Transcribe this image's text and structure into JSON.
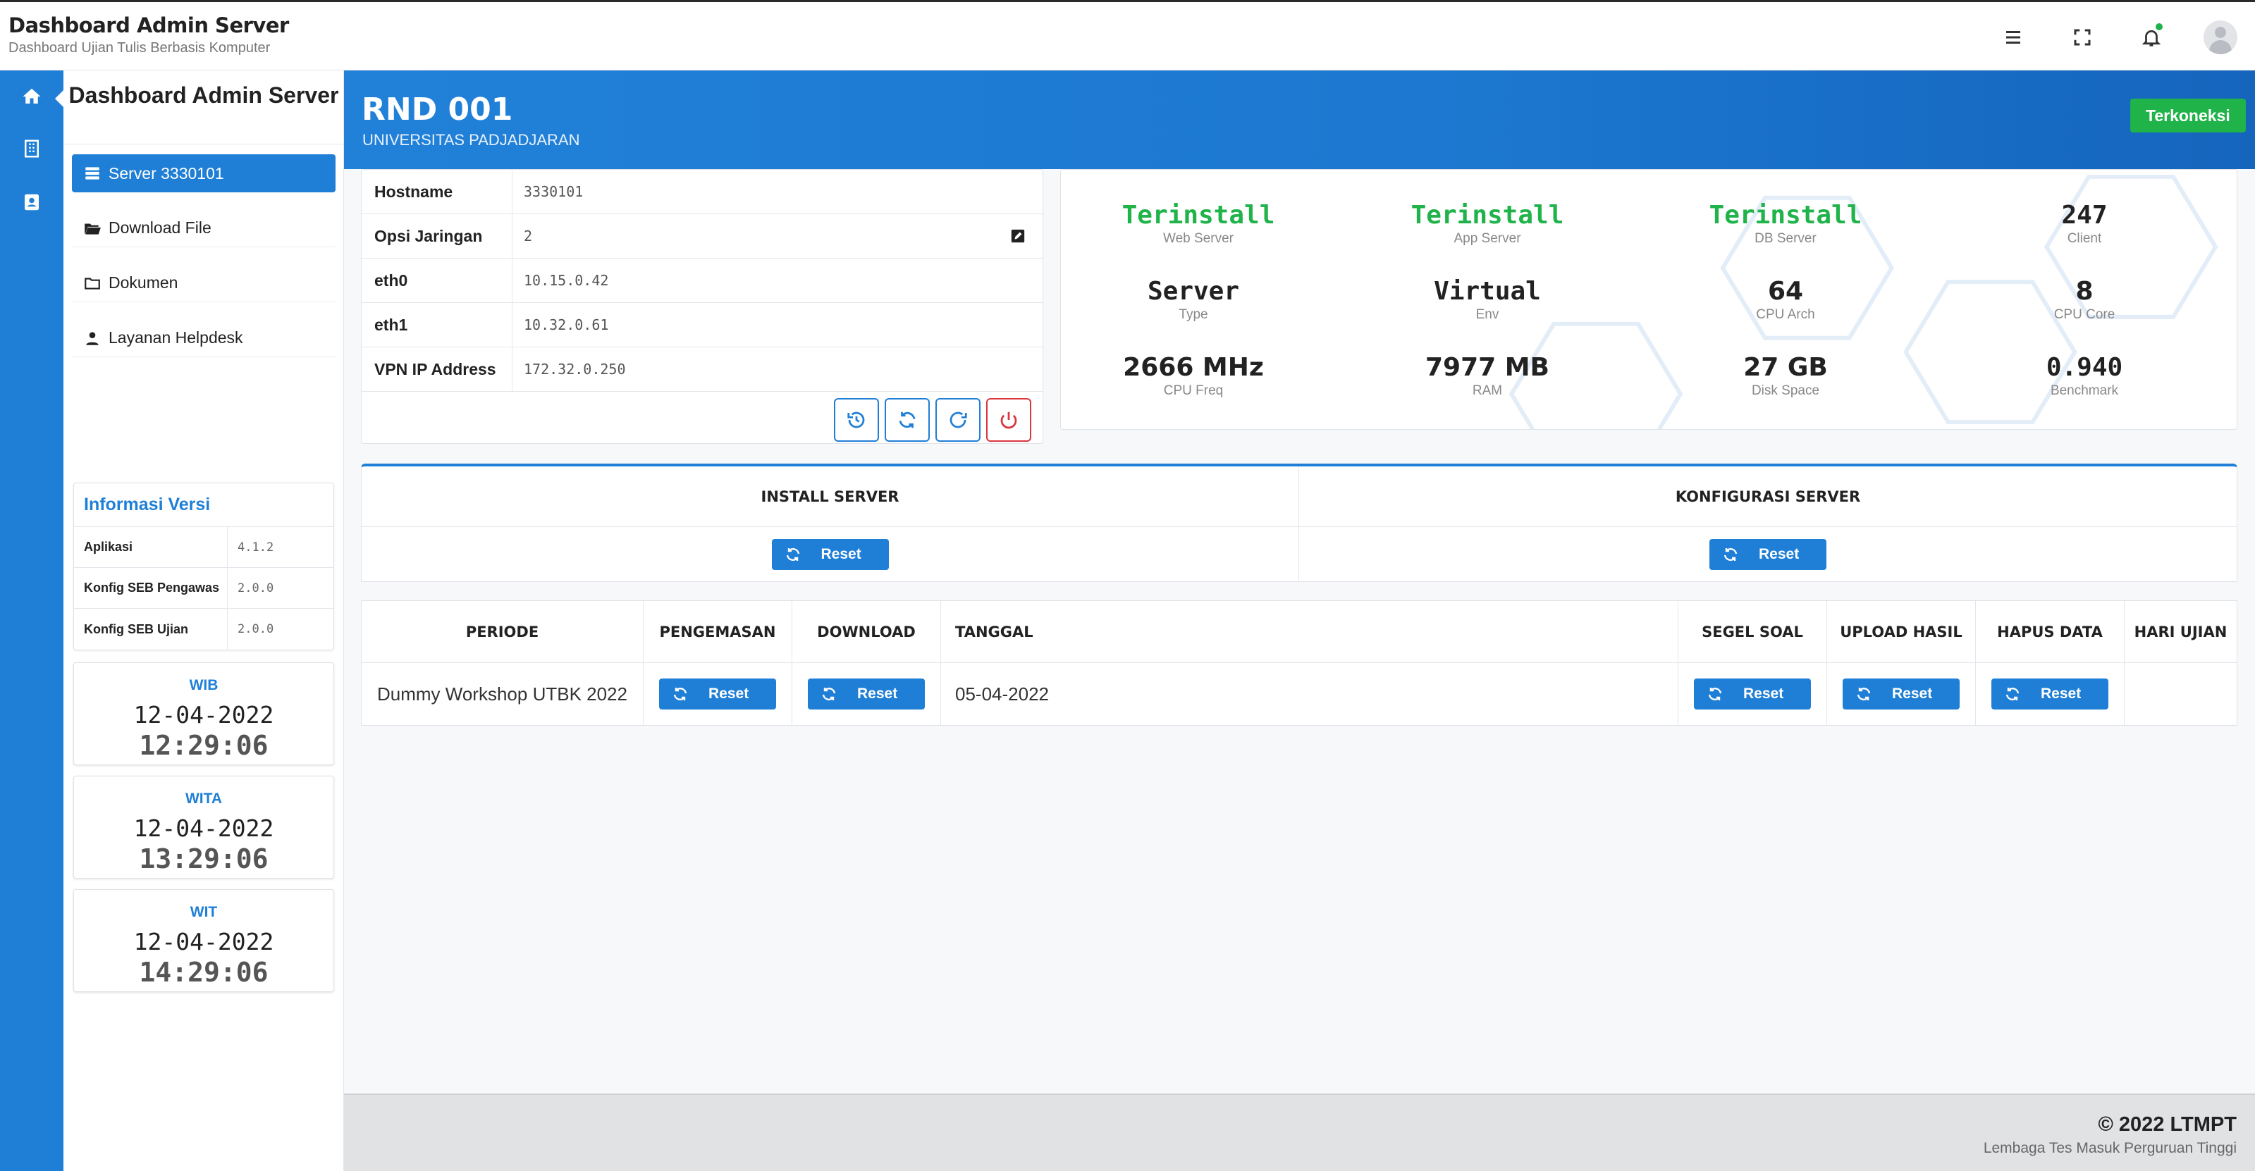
{
  "header": {
    "title": "Dashboard Admin Server",
    "subtitle": "Dashboard Ujian Tulis Berbasis Komputer",
    "icons": [
      "menu-icon",
      "fullscreen-icon",
      "bell-icon",
      "user-avatar"
    ]
  },
  "rail": {
    "items": [
      "home-icon",
      "building-icon",
      "contact-icon"
    ]
  },
  "sidebar": {
    "title": "Dashboard Admin Server",
    "menu": [
      {
        "label": "Server 3330101",
        "icon": "server-icon"
      },
      {
        "label": "Download File",
        "icon": "folder-open-icon"
      },
      {
        "label": "Dokumen",
        "icon": "folder-icon"
      },
      {
        "label": "Layanan Helpdesk",
        "icon": "helpdesk-icon"
      }
    ],
    "version": {
      "title": "Informasi Versi",
      "rows": [
        {
          "key": "Aplikasi",
          "value": "4.1.2"
        },
        {
          "key": "Konfig SEB Pengawas",
          "value": "2.0.0"
        },
        {
          "key": "Konfig SEB Ujian",
          "value": "2.0.0"
        }
      ]
    },
    "clocks": [
      {
        "zone": "WIB",
        "date": "12-04-2022",
        "time": "12:29:06"
      },
      {
        "zone": "WITA",
        "date": "12-04-2022",
        "time": "13:29:06"
      },
      {
        "zone": "WIT",
        "date": "12-04-2022",
        "time": "14:29:06"
      }
    ]
  },
  "main": {
    "title": "RND 001",
    "subtitle": "UNIVERSITAS PADJADJARAN",
    "status": "Terkoneksi",
    "info": [
      {
        "key": "Hostname",
        "value": "3330101"
      },
      {
        "key": "Opsi Jaringan",
        "value": "2"
      },
      {
        "key": "eth0",
        "value": "10.15.0.42"
      },
      {
        "key": "eth1",
        "value": "10.32.0.61"
      },
      {
        "key": "VPN IP Address",
        "value": "172.32.0.250"
      }
    ],
    "actions": [
      "history-icon",
      "sync-icon",
      "redo-icon",
      "power-icon"
    ],
    "stats": [
      {
        "value": "Terinstall",
        "label": "Web Server",
        "green": true
      },
      {
        "value": "Terinstall",
        "label": "App Server",
        "green": true
      },
      {
        "value": "Terinstall",
        "label": "DB Server",
        "green": true
      },
      {
        "value": "247",
        "label": "Client"
      },
      {
        "value": "Server",
        "label": "Type"
      },
      {
        "value": "Virtual",
        "label": "Env"
      },
      {
        "value": "64",
        "label": "CPU Arch"
      },
      {
        "value": "8",
        "label": "CPU Core"
      },
      {
        "value": "2666 MHz",
        "label": "CPU Freq"
      },
      {
        "value": "7977 MB",
        "label": "RAM"
      },
      {
        "value": "27 GB",
        "label": "Disk Space"
      },
      {
        "value": "0.940",
        "label": "Benchmark"
      }
    ],
    "server_sections": [
      {
        "title": "INSTALL SERVER",
        "button": "Reset"
      },
      {
        "title": "KONFIGURASI SERVER",
        "button": "Reset"
      }
    ],
    "period_table": {
      "headers": [
        "PERIODE",
        "PENGEMASAN",
        "DOWNLOAD",
        "TANGGAL",
        "SEGEL SOAL",
        "UPLOAD HASIL",
        "HAPUS DATA",
        "HARI UJIAN"
      ],
      "row": {
        "periode": "Dummy Workshop UTBK 2022",
        "pengemasan": "Reset",
        "download": "Reset",
        "tanggal": "05-04-2022",
        "segel": "Reset",
        "upload": "Reset",
        "hapus": "Reset",
        "hari": ""
      }
    }
  },
  "footer": {
    "copyright": "© 2022 LTMPT",
    "subtitle": "Lembaga Tes Masuk Perguruan Tinggi"
  },
  "colors": {
    "accent": "#1f7fd6",
    "success": "#1fb34a",
    "danger": "#d9363e"
  }
}
